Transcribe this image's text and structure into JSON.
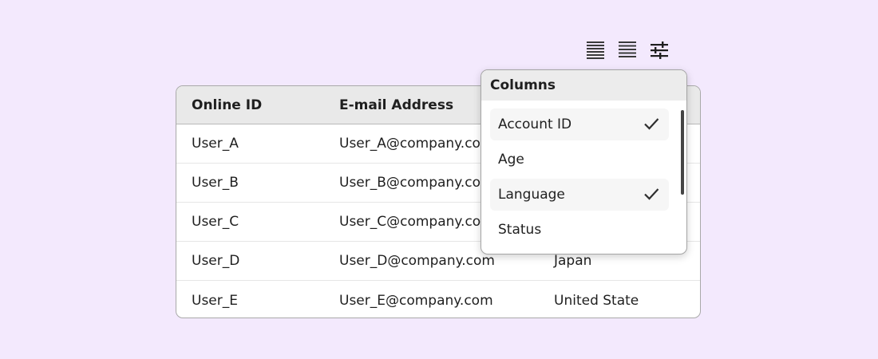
{
  "toolbar": {
    "buttons": [
      {
        "name": "density-compact-icon"
      },
      {
        "name": "density-comfortable-icon"
      },
      {
        "name": "column-settings-icon"
      }
    ]
  },
  "table": {
    "headers": [
      "Online ID",
      "E-mail Address",
      ""
    ],
    "rows": [
      {
        "online_id": "User_A",
        "email": "User_A@company.com",
        "country": ""
      },
      {
        "online_id": "User_B",
        "email": "User_B@company.com",
        "country": ""
      },
      {
        "online_id": "User_C",
        "email": "User_C@company.com",
        "country": ""
      },
      {
        "online_id": "User_D",
        "email": "User_D@company.com",
        "country": "Japan"
      },
      {
        "online_id": "User_E",
        "email": "User_E@company.com",
        "country": "United State"
      }
    ]
  },
  "columns_menu": {
    "title": "Columns",
    "options": [
      {
        "label": "Account ID",
        "checked": true
      },
      {
        "label": "Age",
        "checked": false
      },
      {
        "label": "Language",
        "checked": true
      },
      {
        "label": "Status",
        "checked": false
      }
    ]
  },
  "colors": {
    "background": "#f3e9fd",
    "header_bg": "#e9e9e9",
    "text": "#1f1f1f"
  }
}
